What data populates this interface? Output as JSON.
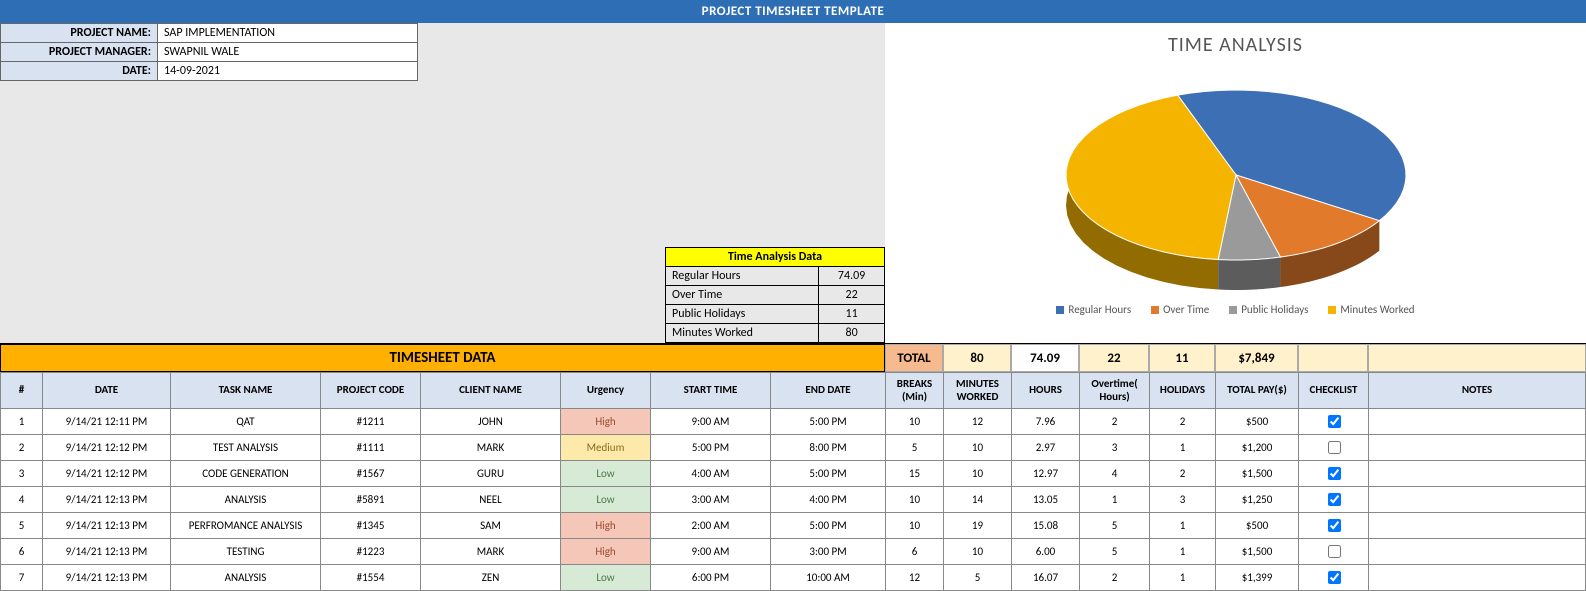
{
  "title": "PROJECT TIMESHEET TEMPLATE",
  "meta": {
    "project_name_label": "PROJECT NAME:",
    "project_name": "SAP IMPLEMENTATION",
    "project_manager_label": "PROJECT MANAGER:",
    "project_manager": "SWAPNIL WALE",
    "date_label": "DATE:",
    "date": "14-09-2021"
  },
  "analysis": {
    "header": "Time Analysis Data",
    "rows": [
      {
        "label": "Regular Hours",
        "value": "74.09"
      },
      {
        "label": "Over Time",
        "value": "22"
      },
      {
        "label": "Public Holidays",
        "value": "11"
      },
      {
        "label": "Minutes Worked",
        "value": "80"
      }
    ]
  },
  "chart": {
    "title": "TIME ANALYSIS",
    "legend": [
      {
        "label": "Regular Hours",
        "color": "#3d6fb5"
      },
      {
        "label": "Over Time",
        "color": "#e27a2c"
      },
      {
        "label": "Public Holidays",
        "color": "#9a9a9a"
      },
      {
        "label": "Minutes Worked",
        "color": "#f4b400"
      }
    ]
  },
  "chart_data": {
    "type": "pie",
    "title": "TIME ANALYSIS",
    "series": [
      {
        "name": "Regular Hours",
        "value": 74.09,
        "color": "#3d6fb5"
      },
      {
        "name": "Over Time",
        "value": 22,
        "color": "#e27a2c"
      },
      {
        "name": "Public Holidays",
        "value": 11,
        "color": "#9a9a9a"
      },
      {
        "name": "Minutes Worked",
        "value": 80,
        "color": "#f4b400"
      }
    ]
  },
  "banner": "TIMESHEET DATA",
  "totals": {
    "label": "TOTAL",
    "minutes": "80",
    "hours": "74.09",
    "overtime": "22",
    "holidays": "11",
    "pay": "$7,849"
  },
  "headers": {
    "num": "#",
    "date": "DATE",
    "task": "TASK NAME",
    "project": "PROJECT CODE",
    "client": "CLIENT NAME",
    "urgency": "Urgency",
    "start": "START TIME",
    "end": "END DATE",
    "breaks": "BREAKS (Min)",
    "minutes": "MINUTES WORKED",
    "hours": "HOURS",
    "overtime": "Overtime( Hours)",
    "holidays": "HOLIDAYS",
    "pay": "TOTAL PAY($)",
    "checklist": "CHECKLIST",
    "notes": "NOTES"
  },
  "rows": [
    {
      "num": "1",
      "date": "9/14/21 12:11 PM",
      "task": "QAT",
      "project": "#1211",
      "client": "JOHN",
      "urgency": "High",
      "urgency_class": "urg-high",
      "start": "9:00 AM",
      "end": "5:00 PM",
      "breaks": "10",
      "minutes": "12",
      "hours": "7.96",
      "overtime": "2",
      "holidays": "2",
      "pay": "$500",
      "checked": true
    },
    {
      "num": "2",
      "date": "9/14/21 12:12 PM",
      "task": "TEST ANALYSIS",
      "project": "#1111",
      "client": "MARK",
      "urgency": "Medium",
      "urgency_class": "urg-med",
      "start": "5:00 PM",
      "end": "8:00 PM",
      "breaks": "5",
      "minutes": "10",
      "hours": "2.97",
      "overtime": "3",
      "holidays": "1",
      "pay": "$1,200",
      "checked": false
    },
    {
      "num": "3",
      "date": "9/14/21 12:12 PM",
      "task": "CODE GENERATION",
      "project": "#1567",
      "client": "GURU",
      "urgency": "Low",
      "urgency_class": "urg-low",
      "start": "4:00 AM",
      "end": "5:00 PM",
      "breaks": "15",
      "minutes": "10",
      "hours": "12.97",
      "overtime": "4",
      "holidays": "2",
      "pay": "$1,500",
      "checked": true
    },
    {
      "num": "4",
      "date": "9/14/21 12:13 PM",
      "task": "ANALYSIS",
      "project": "#5891",
      "client": "NEEL",
      "urgency": "Low",
      "urgency_class": "urg-low",
      "start": "3:00 AM",
      "end": "4:00 PM",
      "breaks": "10",
      "minutes": "14",
      "hours": "13.05",
      "overtime": "1",
      "holidays": "3",
      "pay": "$1,250",
      "checked": true
    },
    {
      "num": "5",
      "date": "9/14/21 12:13 PM",
      "task": "PERFROMANCE ANALYSIS",
      "project": "#1345",
      "client": "SAM",
      "urgency": "High",
      "urgency_class": "urg-high",
      "start": "2:00 AM",
      "end": "5:00 PM",
      "breaks": "10",
      "minutes": "19",
      "hours": "15.08",
      "overtime": "5",
      "holidays": "1",
      "pay": "$500",
      "checked": true
    },
    {
      "num": "6",
      "date": "9/14/21 12:13 PM",
      "task": "TESTING",
      "project": "#1223",
      "client": "MARK",
      "urgency": "High",
      "urgency_class": "urg-high",
      "start": "9:00 AM",
      "end": "3:00 PM",
      "breaks": "6",
      "minutes": "10",
      "hours": "6.00",
      "overtime": "5",
      "holidays": "1",
      "pay": "$1,500",
      "checked": false
    },
    {
      "num": "7",
      "date": "9/14/21 12:13 PM",
      "task": "ANALYSIS",
      "project": "#1554",
      "client": "ZEN",
      "urgency": "Low",
      "urgency_class": "urg-low",
      "start": "6:00 PM",
      "end": "10:00 AM",
      "breaks": "12",
      "minutes": "5",
      "hours": "16.07",
      "overtime": "2",
      "holidays": "1",
      "pay": "$1,399",
      "checked": true
    }
  ]
}
